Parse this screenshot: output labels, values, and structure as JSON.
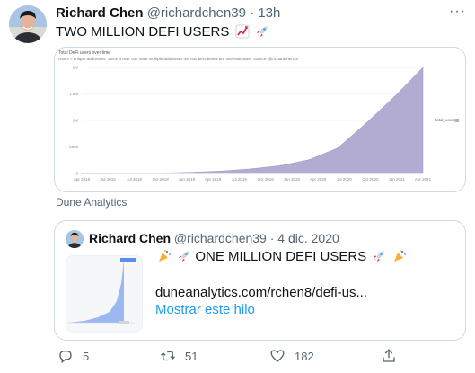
{
  "tweet": {
    "author_name": "Richard Chen",
    "author_handle": "@richardchen39",
    "separator": "·",
    "time": "13h",
    "more_label": "···",
    "text": "TWO MILLION DEFI USERS",
    "emoji": [
      "chart-increasing-emoji",
      "rocket-emoji"
    ]
  },
  "chart_data": {
    "type": "area",
    "title": "Total DeFi users over time",
    "subtitle": "Users = unique addresses. Since a user can have multiple addresses the numbers below are overestimates. Source: @richardchen39",
    "x": [
      "Apr 2018",
      "Jul 2018",
      "Oct 2018",
      "Jan 2019",
      "Apr 2019",
      "Jul 2019",
      "Oct 2019",
      "Jan 2020",
      "Apr 2020",
      "Jul 2020",
      "Oct 2020",
      "Jan 2021",
      "Apr 2021"
    ],
    "x_tick_labels": [
      "Apr 2018",
      "Jul 2018",
      "Jul 2018",
      "Oct 2018",
      "Jan 2019",
      "Apr 2019",
      "Jul 2019",
      "Oct 2019",
      "Jan 2020",
      "Apr 2020",
      "Jul 2020",
      "Oct 2020",
      "Jan 2021",
      "Apr 2021"
    ],
    "series": [
      {
        "name": "total_users",
        "values": [
          1000,
          3000,
          6000,
          12000,
          25000,
          50000,
          90000,
          150000,
          260000,
          480000,
          950000,
          1450000,
          2000000
        ]
      }
    ],
    "y_tick_labels": [
      "0",
      "500k",
      "1M",
      "1.5M",
      "2M"
    ],
    "ylim": [
      0,
      2000000
    ],
    "grid": true,
    "legend_position": "right",
    "color": "#b2abd2"
  },
  "source": {
    "label": "Dune Analytics"
  },
  "quote": {
    "author_name": "Richard Chen",
    "author_handle": "@richardchen39",
    "separator": "·",
    "date": "4 dic. 2020",
    "text": "ONE MILLION DEFI USERS",
    "link": "duneanalytics.com/rchen8/defi-us...",
    "show_thread": "Mostrar este hilo"
  },
  "actions": {
    "reply_count": "5",
    "retweet_count": "51",
    "like_count": "182"
  },
  "colors": {
    "text_primary": "#0f1419",
    "text_secondary": "#536471",
    "link": "#1d9bf0",
    "border": "#cfd9de",
    "area": "#b2abd2"
  }
}
